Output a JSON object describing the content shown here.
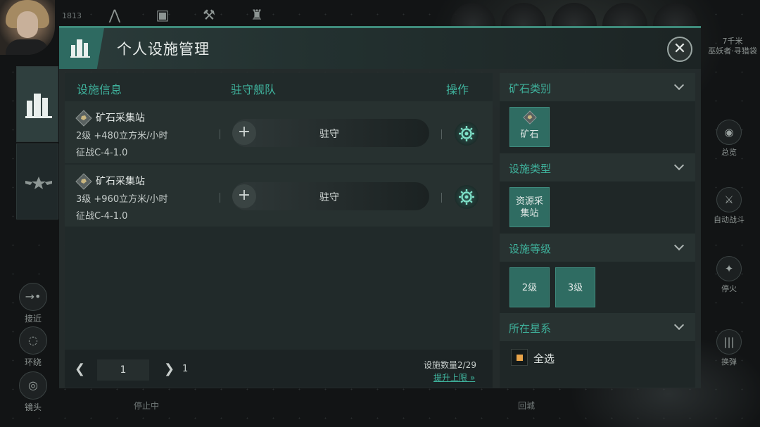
{
  "hud": {
    "top_time": "1813",
    "distance": "7千米",
    "target": "巫妖者·寻猎袋",
    "stop_label": "停止中",
    "return_label": "回城",
    "left_buttons": [
      "接近",
      "环绕",
      "镜头"
    ],
    "right_buttons": [
      "总览",
      "自动战斗",
      "停火",
      "换弹"
    ]
  },
  "dialog": {
    "title": "个人设施管理",
    "columns": {
      "info": "设施信息",
      "garrison": "驻守舰队",
      "action": "操作"
    },
    "rows": [
      {
        "name": "矿石采集站",
        "level_output": "2级 +480立方米/小时",
        "location": "征战C-4-1.0",
        "garrison_label": "驻守"
      },
      {
        "name": "矿石采集站",
        "level_output": "3级 +960立方米/小时",
        "location": "征战C-4-1.0",
        "garrison_label": "驻守"
      }
    ],
    "pager": {
      "current": "1",
      "total": "1",
      "count_label": "设施数量2/29",
      "upgrade_label": "提升上限"
    }
  },
  "filters": {
    "ore_type": {
      "title": "矿石类别",
      "options": [
        "矿石"
      ]
    },
    "facility_type": {
      "title": "设施类型",
      "options": [
        "资源采集站"
      ]
    },
    "facility_level": {
      "title": "设施等级",
      "options": [
        "2级",
        "3级"
      ]
    },
    "star_system": {
      "title": "所在星系",
      "select_all": "全选"
    }
  },
  "colors": {
    "accent": "#3fb39d",
    "chip": "#2f6c62",
    "checkbox": "#e8a44a"
  }
}
